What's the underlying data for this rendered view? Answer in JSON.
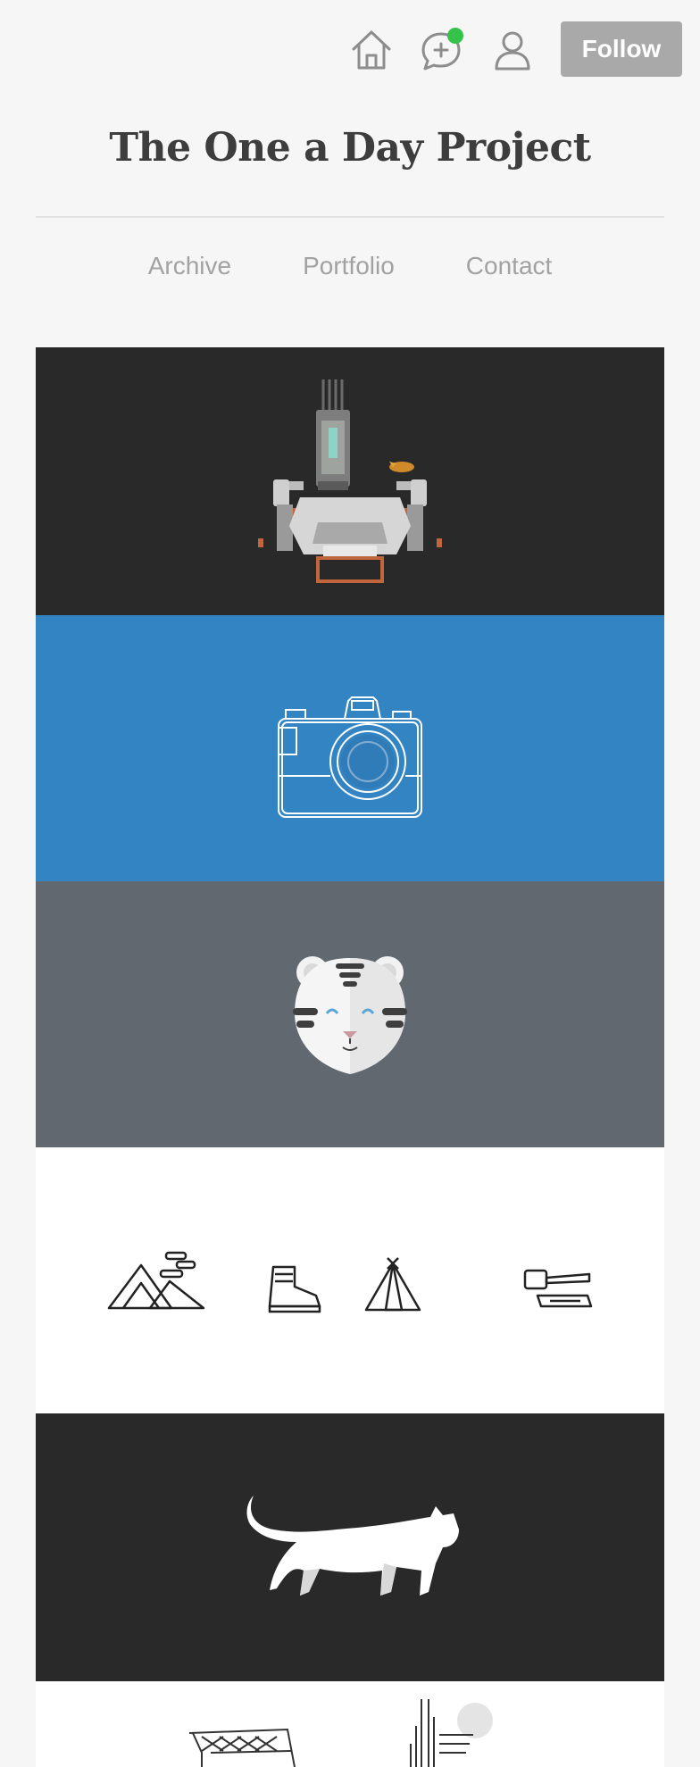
{
  "header": {
    "follow_label": "Follow",
    "icons": [
      "home-icon",
      "chat-add-icon",
      "user-icon"
    ],
    "notification_color": "#35c24a"
  },
  "blog": {
    "title": "The One a Day Project"
  },
  "nav": {
    "items": [
      {
        "label": "Archive"
      },
      {
        "label": "Portfolio"
      },
      {
        "label": "Contact"
      }
    ]
  },
  "posts": [
    {
      "name": "robot-illustration",
      "background": "#292929"
    },
    {
      "name": "camera-illustration",
      "background": "#3384c3"
    },
    {
      "name": "tiger-illustration",
      "background": "#616870"
    },
    {
      "name": "camping-icons-illustration",
      "background": "#ffffff"
    },
    {
      "name": "cat-illustration",
      "background": "#292929"
    },
    {
      "name": "buildings-illustration",
      "background": "#ffffff"
    }
  ]
}
